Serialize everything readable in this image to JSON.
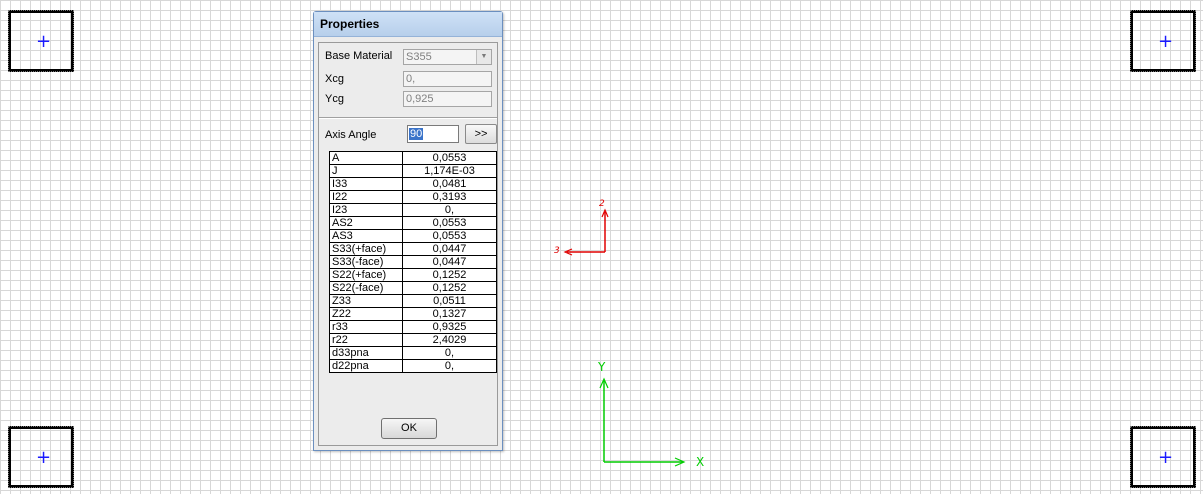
{
  "dialog": {
    "title": "Properties",
    "base_material_label": "Base Material",
    "base_material_value": "S355",
    "xcg_label": "Xcg",
    "xcg_value": "0,",
    "ycg_label": "Ycg",
    "ycg_value": "0,925",
    "axis_angle_label": "Axis Angle",
    "axis_angle_value": "90",
    "more_button_label": ">>",
    "ok_button_label": "OK",
    "properties": [
      {
        "name": "A",
        "value": "0,0553"
      },
      {
        "name": "J",
        "value": "1,174E-03"
      },
      {
        "name": "I33",
        "value": "0,0481"
      },
      {
        "name": "I22",
        "value": "0,3193"
      },
      {
        "name": "I23",
        "value": "0,"
      },
      {
        "name": "AS2",
        "value": "0,0553"
      },
      {
        "name": "AS3",
        "value": "0,0553"
      },
      {
        "name": "S33(+face)",
        "value": "0,0447"
      },
      {
        "name": "S33(-face)",
        "value": "0,0447"
      },
      {
        "name": "S22(+face)",
        "value": "0,1252"
      },
      {
        "name": "S22(-face)",
        "value": "0,1252"
      },
      {
        "name": "Z33",
        "value": "0,0511"
      },
      {
        "name": "Z22",
        "value": "0,1327"
      },
      {
        "name": "r33",
        "value": "0,9325"
      },
      {
        "name": "r22",
        "value": "2,4029"
      },
      {
        "name": "d33pna",
        "value": "0,"
      },
      {
        "name": "d22pna",
        "value": "0,"
      }
    ]
  },
  "local_axes": {
    "axis2_label": "2",
    "axis3_label": "3",
    "color": "#e00000"
  },
  "global_axes": {
    "y_label": "Y",
    "x_label": "X",
    "color": "#00cc00"
  },
  "corner_marker": {
    "symbol": "+",
    "color": "#1a1aff"
  }
}
